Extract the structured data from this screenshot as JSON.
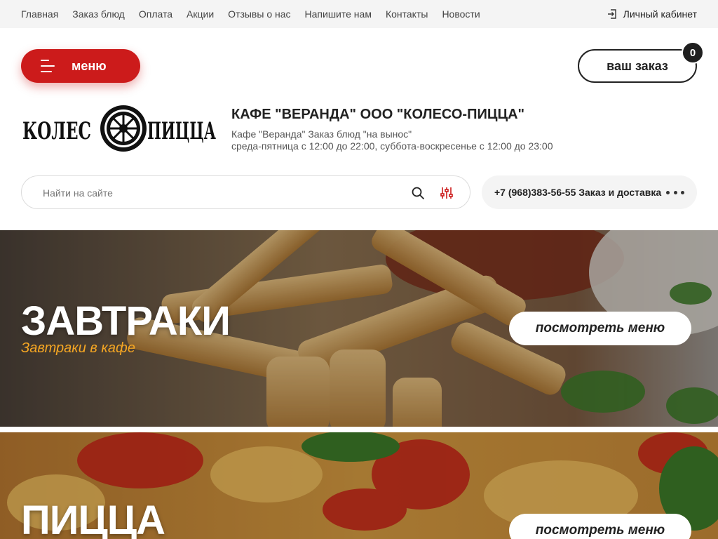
{
  "topnav": {
    "items": [
      "Главная",
      "Заказ блюд",
      "Оплата",
      "Акции",
      "Отзывы о нас",
      "Напишите нам",
      "Контакты",
      "Новости"
    ],
    "cabinet_label": "Личный кабинет",
    "cabinet_icon": "login-icon"
  },
  "header": {
    "menu_label": "меню",
    "menu_icon": "burger-icon",
    "order_label": "ваш заказ",
    "order_count": "0",
    "logo_text": "КОЛЕСО ПИЦЦА",
    "company_name": "КАФЕ \"ВЕРАНДА\" ООО \"КОЛЕСО-ПИЦЦА\"",
    "company_tagline": "Кафе \"Веранда\" Заказ блюд \"на вынос\"",
    "company_hours": "среда-пятница с 12:00 до 22:00, суббота-воскресенье с 12:00 до 23:00"
  },
  "search": {
    "placeholder": "Найти на сайте",
    "value": ""
  },
  "phone": {
    "text": "+7 (968)383-56-55 Заказ и доставка"
  },
  "banners": [
    {
      "title": "ЗАВТРАКИ",
      "subtitle": "Завтраки в кафе",
      "button": "посмотреть меню"
    },
    {
      "title": "ПИЦЦА",
      "subtitle": "",
      "button": "посмотреть меню"
    }
  ],
  "colors": {
    "accent": "#cc1b1b",
    "subtitle": "#f5a623",
    "topbar_bg": "#f4f4f4"
  }
}
